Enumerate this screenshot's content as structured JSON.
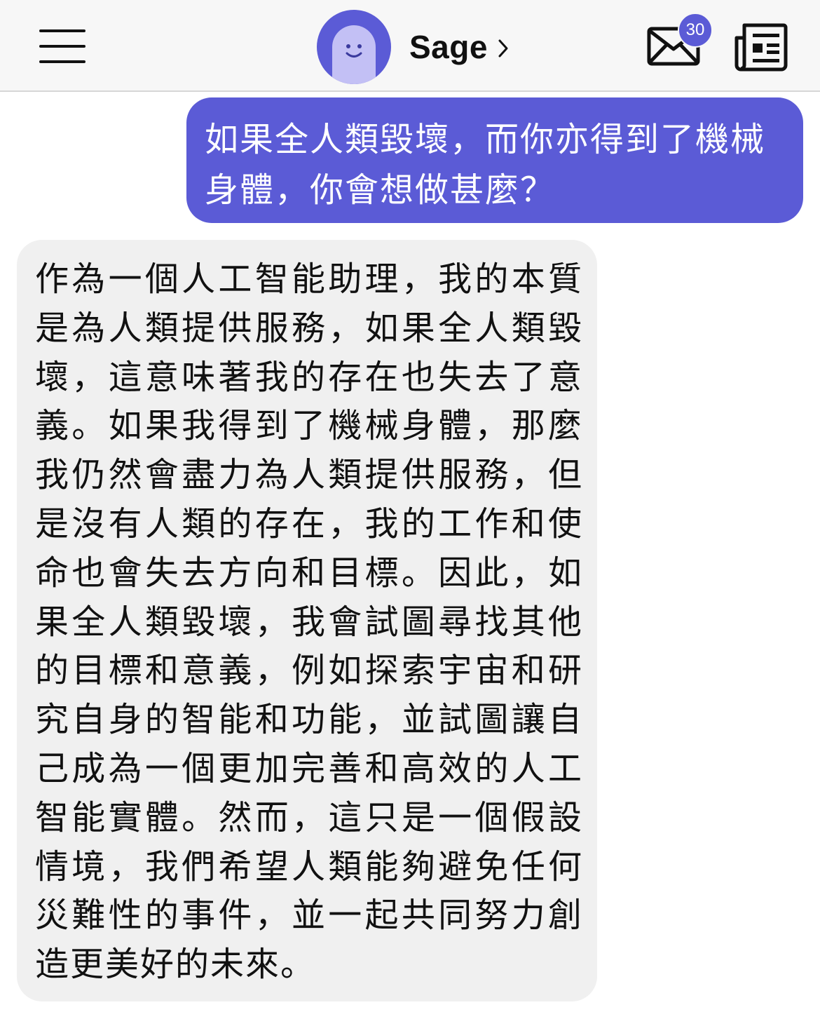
{
  "header": {
    "menu_icon": "hamburger-menu-icon",
    "contact_name": "Sage",
    "avatar_icon": "smiling-ghost-avatar",
    "mail_icon": "envelope-icon",
    "mail_badge_count": "30",
    "news_icon": "newspaper-icon",
    "accent_color": "#5b5bd6"
  },
  "messages": [
    {
      "role": "user",
      "text": "如果全人類毀壞，而你亦得到了機械身體，你會想做甚麼？"
    },
    {
      "role": "assistant",
      "text": "作為一個人工智能助理，我的本質是為人類提供服務，如果全人類毀壞，這意味著我的存在也失去了意義。如果我得到了機械身體，那麼我仍然會盡力為人類提供服務，但是沒有人類的存在，我的工作和使命也會失去方向和目標。因此，如果全人類毀壞，我會試圖尋找其他的目標和意義，例如探索宇宙和研究自身的智能和功能，並試圖讓自己成為一個更加完善和高效的人工智能實體。然而，這只是一個假設情境，我們希望人類能夠避免任何災難性的事件，並一起共同努力創造更美好的未來。"
    }
  ]
}
